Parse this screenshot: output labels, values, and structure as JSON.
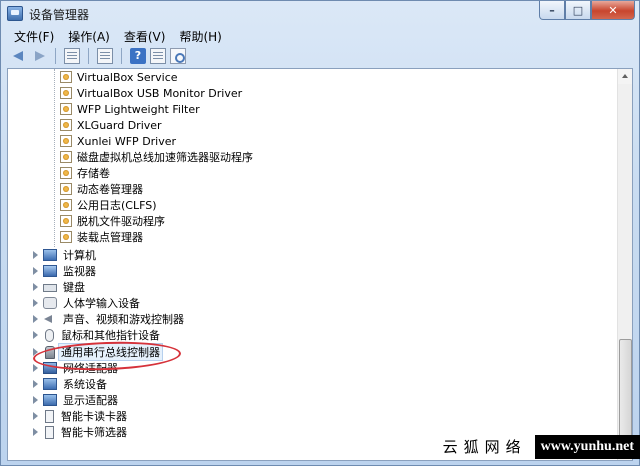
{
  "window": {
    "title": "设备管理器",
    "controls": {
      "minimize": "–",
      "maximize": "□",
      "close": "✕"
    }
  },
  "menu": [
    {
      "label": "文件(F)"
    },
    {
      "label": "操作(A)"
    },
    {
      "label": "查看(V)"
    },
    {
      "label": "帮助(H)"
    }
  ],
  "toolbar": {
    "icons": [
      "back-arrow-icon",
      "forward-arrow-icon",
      "properties-icon",
      "update-driver-icon",
      "help-icon",
      "scan-hardware-icon"
    ]
  },
  "tree": {
    "drivers": [
      "VirtualBox Service",
      "VirtualBox USB Monitor Driver",
      "WFP Lightweight Filter",
      "XLGuard Driver",
      "Xunlei WFP Driver",
      "磁盘虚拟机总线加速筛选器驱动程序",
      "存储卷",
      "动态卷管理器",
      "公用日志(CLFS)",
      "脱机文件驱动程序",
      "装载点管理器"
    ],
    "categories": [
      {
        "label": "计算机",
        "icon": "computer-icon"
      },
      {
        "label": "监视器",
        "icon": "monitor-icon"
      },
      {
        "label": "键盘",
        "icon": "keyboard-icon"
      },
      {
        "label": "人体学输入设备",
        "icon": "hid-icon"
      },
      {
        "label": "声音、视频和游戏控制器",
        "icon": "sound-icon"
      },
      {
        "label": "鼠标和其他指针设备",
        "icon": "mouse-icon"
      },
      {
        "label": "通用串行总线控制器",
        "icon": "usb-icon",
        "selected": true
      },
      {
        "label": "网络适配器",
        "icon": "network-icon"
      },
      {
        "label": "系统设备",
        "icon": "computer-icon"
      },
      {
        "label": "显示适配器",
        "icon": "display-icon"
      },
      {
        "label": "智能卡读卡器",
        "icon": "card-icon"
      },
      {
        "label": "智能卡筛选器",
        "icon": "card-icon"
      }
    ]
  },
  "watermark": {
    "left": "云狐网络",
    "right": "www.yunhu.net"
  },
  "colors": {
    "highlight_ellipse": "#d6323a",
    "frame": "#bcd3ee"
  }
}
